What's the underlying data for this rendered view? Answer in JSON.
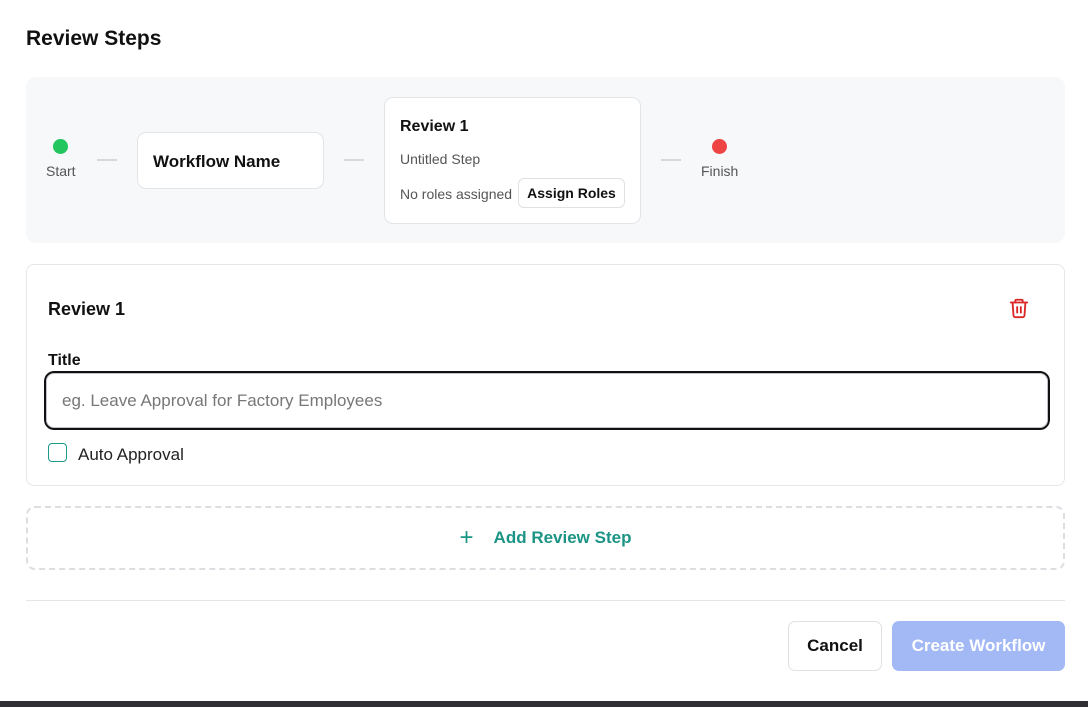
{
  "heading": "Review Steps",
  "flow": {
    "start_label": "Start",
    "start_color": "#22c55e",
    "workflow_name": "Workflow Name",
    "step": {
      "title": "Review 1",
      "subtitle": "Untitled Step",
      "roles_text": "No roles assigned",
      "assign_button": "Assign Roles"
    },
    "finish_label": "Finish",
    "finish_color": "#ef4444"
  },
  "review_panel": {
    "title": "Review 1",
    "delete_icon": "trash-icon",
    "field_label": "Title",
    "title_input": {
      "value": "",
      "placeholder": "eg. Leave Approval for Factory Employees"
    },
    "auto_approval_label": "Auto Approval",
    "auto_approval_checked": false
  },
  "add_step": {
    "icon": "plus-icon",
    "label": "Add Review Step"
  },
  "footer": {
    "cancel_label": "Cancel",
    "create_label": "Create Workflow"
  },
  "colors": {
    "accent": "#199a8b",
    "primary_disabled": "#a3b9f6",
    "danger": "#dc2626"
  }
}
